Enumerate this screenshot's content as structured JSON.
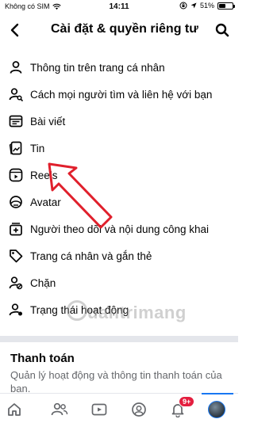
{
  "status_bar": {
    "carrier": "Không có SIM",
    "time": "14:11",
    "battery": "51%"
  },
  "header": {
    "title": "Cài đặt & quyền riêng tư"
  },
  "menu": {
    "items": [
      {
        "label": "Thông tin trên trang cá nhân",
        "icon": "profile-info-icon"
      },
      {
        "label": "Cách mọi người tìm và liên hệ với bạn",
        "icon": "find-contact-icon"
      },
      {
        "label": "Bài viết",
        "icon": "posts-icon"
      },
      {
        "label": "Tin",
        "icon": "stories-icon"
      },
      {
        "label": "Reels",
        "icon": "reels-icon"
      },
      {
        "label": "Avatar",
        "icon": "avatar-icon"
      },
      {
        "label": "Người theo dõi và nội dung công khai",
        "icon": "followers-icon"
      },
      {
        "label": "Trang cá nhân và gắn thẻ",
        "icon": "tag-icon"
      },
      {
        "label": "Chặn",
        "icon": "block-icon"
      },
      {
        "label": "Trạng thái hoạt động",
        "icon": "activity-status-icon"
      }
    ]
  },
  "payment": {
    "title": "Thanh toán",
    "description": "Quản lý hoạt động và thông tin thanh toán của bạn."
  },
  "tabbar": {
    "notification_badge": "9+"
  },
  "watermark": {
    "text": "uantrimang"
  },
  "colors": {
    "accent": "#1877f2",
    "badge": "#e41e3f",
    "annotation_arrow": "#e0202c"
  }
}
